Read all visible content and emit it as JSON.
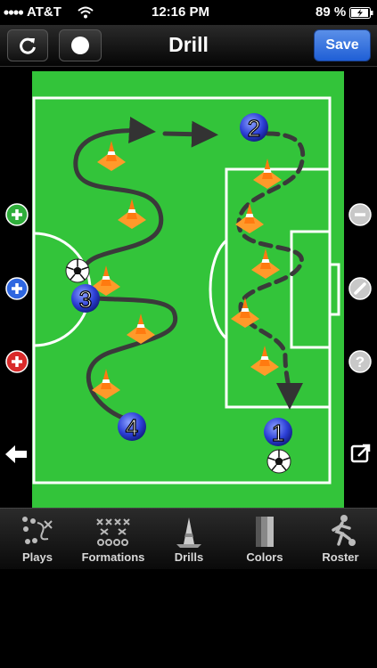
{
  "status": {
    "carrier": "AT&T",
    "time": "12:16 PM",
    "battery": "89 %"
  },
  "nav": {
    "title": "Drill",
    "save_label": "Save",
    "left_icons": [
      "refresh-icon",
      "circle-icon"
    ]
  },
  "players": [
    "1",
    "2",
    "3",
    "4"
  ],
  "side_left": [
    "zoom-in-icon",
    "player-add-icon",
    "remove-icon",
    "back-arrow-icon"
  ],
  "side_right": [
    "minus-icon",
    "pencil-icon",
    "help-icon",
    "share-icon"
  ],
  "tabs": [
    {
      "label": "Plays",
      "icon": "plays-icon"
    },
    {
      "label": "Formations",
      "icon": "formations-icon"
    },
    {
      "label": "Drills",
      "icon": "cone-icon"
    },
    {
      "label": "Colors",
      "icon": "colors-icon"
    },
    {
      "label": "Roster",
      "icon": "player-icon"
    }
  ],
  "colors": {
    "field": "#33c43a",
    "line": "#ffffff",
    "save": "#2f6fe0",
    "cone": "#ff8a1c",
    "player": "#2c3fd6"
  }
}
